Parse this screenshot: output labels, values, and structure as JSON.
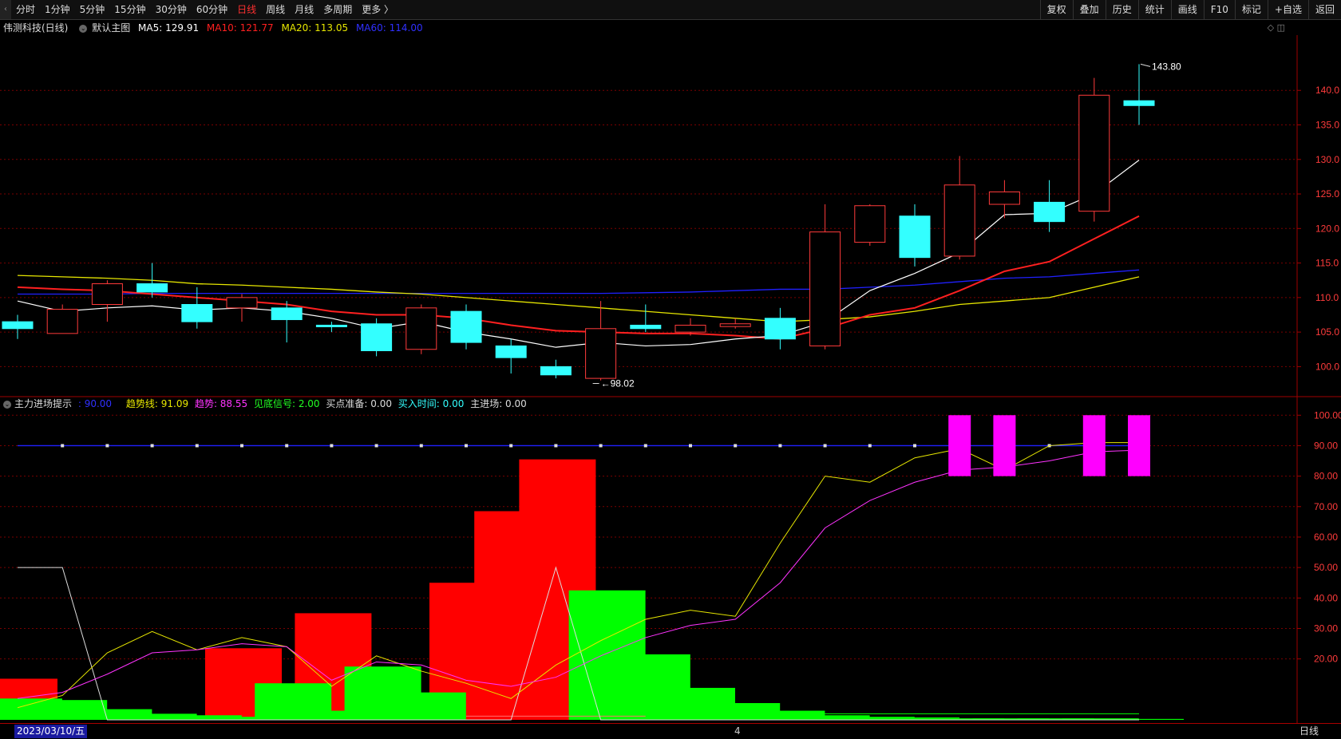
{
  "toolbar": {
    "back_icon": "chevron-left-icon",
    "periods": [
      {
        "label": "分时",
        "active": false
      },
      {
        "label": "1分钟",
        "active": false
      },
      {
        "label": "5分钟",
        "active": false
      },
      {
        "label": "15分钟",
        "active": false
      },
      {
        "label": "30分钟",
        "active": false
      },
      {
        "label": "60分钟",
        "active": false
      },
      {
        "label": "日线",
        "active": true
      },
      {
        "label": "周线",
        "active": false
      },
      {
        "label": "月线",
        "active": false
      },
      {
        "label": "多周期",
        "active": false
      },
      {
        "label": "更多 〉",
        "active": false
      }
    ],
    "actions": [
      "复权",
      "叠加",
      "历史",
      "统计",
      "画线",
      "F10",
      "标记",
      "+自选",
      "返回"
    ]
  },
  "main_info": {
    "stock": "伟测科技(日线)",
    "indicator": "默认主图",
    "ma5": "MA5: 129.91",
    "ma10": "MA10: 121.77",
    "ma20": "MA20: 113.05",
    "ma60": "MA60: 114.00"
  },
  "sub_info": {
    "name": "主力进场提示",
    "v1": ": 90.00",
    "trend_line": "趋势线: 91.09",
    "trend": "趋势: 88.55",
    "bottom_signal": "见底信号: 2.00",
    "buy_prepare": "买点准备: 0.00",
    "buy_time": "买入时间: 0.00",
    "main_entry": "主进场: 0.00"
  },
  "bottom": {
    "date": "2023/03/10/五",
    "marker": "4",
    "period": "日线"
  },
  "colors": {
    "up": "#ff3b3b",
    "down": "#33ffff",
    "ma5": "#ffffff",
    "ma10": "#ff2020",
    "ma20": "#e6e600",
    "ma60": "#2020ff",
    "grid": "#7a0000"
  },
  "chart_data": [
    {
      "type": "candlestick",
      "y_ticks": [
        100,
        105,
        110,
        115,
        120,
        125,
        130,
        135,
        140
      ],
      "ylim": [
        96,
        148
      ],
      "annotations": {
        "high": "143.80",
        "low": "98.02"
      },
      "candles": [
        {
          "o": 106.5,
          "h": 107.5,
          "l": 104.0,
          "c": 105.5
        },
        {
          "o": 104.8,
          "h": 109.0,
          "l": 104.8,
          "c": 108.3
        },
        {
          "o": 109.0,
          "h": 112.5,
          "l": 106.5,
          "c": 112.0
        },
        {
          "o": 112.0,
          "h": 115.0,
          "l": 110.0,
          "c": 110.8
        },
        {
          "o": 109.0,
          "h": 111.5,
          "l": 105.5,
          "c": 106.5
        },
        {
          "o": 108.5,
          "h": 110.5,
          "l": 106.5,
          "c": 110.0
        },
        {
          "o": 108.5,
          "h": 109.5,
          "l": 103.5,
          "c": 106.8
        },
        {
          "o": 106.0,
          "h": 106.5,
          "l": 105.0,
          "c": 105.8
        },
        {
          "o": 106.2,
          "h": 107.0,
          "l": 101.5,
          "c": 102.3
        },
        {
          "o": 102.5,
          "h": 109.0,
          "l": 101.8,
          "c": 108.5
        },
        {
          "o": 108.0,
          "h": 109.0,
          "l": 102.5,
          "c": 103.5
        },
        {
          "o": 103.0,
          "h": 104.0,
          "l": 99.0,
          "c": 101.3
        },
        {
          "o": 100.0,
          "h": 101.0,
          "l": 98.3,
          "c": 98.8
        },
        {
          "o": 98.3,
          "h": 109.5,
          "l": 98.0,
          "c": 105.5
        },
        {
          "o": 106.0,
          "h": 109.0,
          "l": 105.0,
          "c": 105.5
        },
        {
          "o": 105.0,
          "h": 107.0,
          "l": 104.5,
          "c": 106.0
        },
        {
          "o": 105.8,
          "h": 107.0,
          "l": 105.5,
          "c": 106.2
        },
        {
          "o": 107.0,
          "h": 108.5,
          "l": 102.5,
          "c": 104.0
        },
        {
          "o": 103.0,
          "h": 123.5,
          "l": 102.5,
          "c": 119.5
        },
        {
          "o": 118.0,
          "h": 123.5,
          "l": 117.5,
          "c": 123.3
        },
        {
          "o": 121.8,
          "h": 123.5,
          "l": 114.5,
          "c": 115.8
        },
        {
          "o": 116.0,
          "h": 130.5,
          "l": 115.5,
          "c": 126.3
        },
        {
          "o": 123.5,
          "h": 127.0,
          "l": 121.5,
          "c": 125.3
        },
        {
          "o": 123.8,
          "h": 127.0,
          "l": 119.5,
          "c": 121.0
        },
        {
          "o": 122.5,
          "h": 141.8,
          "l": 121.0,
          "c": 139.3
        },
        {
          "o": 138.5,
          "h": 143.8,
          "l": 135.0,
          "c": 137.8
        }
      ],
      "ma5": [
        109.5,
        108.0,
        108.5,
        108.8,
        108.2,
        108.5,
        108.0,
        107.0,
        105.5,
        106.5,
        105.0,
        104.0,
        102.8,
        103.5,
        103.0,
        103.2,
        104.0,
        104.5,
        106.5,
        111.0,
        113.5,
        116.5,
        122.0,
        122.2,
        125.0,
        129.9
      ],
      "ma10": [
        111.5,
        111.2,
        111.0,
        110.5,
        110.0,
        109.5,
        109.0,
        108.0,
        107.5,
        107.5,
        107.0,
        106.0,
        105.2,
        105.0,
        104.8,
        104.8,
        104.5,
        104.0,
        105.5,
        107.5,
        108.5,
        111.0,
        113.8,
        115.2,
        118.5,
        121.8
      ],
      "ma20": [
        113.2,
        113.0,
        112.8,
        112.5,
        112.0,
        111.8,
        111.5,
        111.2,
        110.8,
        110.5,
        110.0,
        109.5,
        109.0,
        108.5,
        108.0,
        107.5,
        107.0,
        106.5,
        106.8,
        107.2,
        108.0,
        109.0,
        109.5,
        110.0,
        111.5,
        113.0
      ],
      "ma60": [
        110.5,
        110.5,
        110.5,
        110.6,
        110.6,
        110.6,
        110.6,
        110.6,
        110.6,
        110.6,
        110.6,
        110.6,
        110.6,
        110.6,
        110.7,
        110.8,
        111.0,
        111.2,
        111.2,
        111.5,
        111.8,
        112.3,
        112.8,
        113.0,
        113.5,
        114.0
      ]
    },
    {
      "type": "bar",
      "name": "主力进场提示",
      "y_ticks": [
        20,
        30,
        40,
        50,
        60,
        70,
        80,
        90,
        100
      ],
      "ylim": [
        0,
        104
      ],
      "red_bars": [
        13.5,
        0,
        0,
        0,
        0,
        23.5,
        0,
        35,
        0,
        0,
        45,
        68.5,
        85.5,
        0,
        0,
        0,
        0,
        0,
        0,
        0,
        0,
        0,
        0,
        0,
        0,
        0
      ],
      "green_bars": [
        7,
        6.5,
        3.5,
        2,
        1.5,
        1,
        12,
        3,
        17.5,
        9,
        0,
        0,
        0,
        42.5,
        21.5,
        10.5,
        5.5,
        3,
        1.5,
        1,
        0.8,
        0.5,
        0.5,
        0.5,
        0.5,
        0.3
      ],
      "signal_bars": [
        0,
        0,
        0,
        0,
        0,
        0,
        0,
        0,
        0,
        0,
        0,
        0,
        0,
        0,
        0,
        0,
        0,
        0,
        0,
        0,
        0,
        1,
        1,
        0,
        1,
        1
      ],
      "level_line": 90,
      "white_line": [
        50,
        50,
        0,
        0,
        0,
        0,
        0,
        0,
        0,
        0,
        0,
        0,
        50,
        0,
        0,
        0,
        0,
        0,
        0,
        0,
        0,
        0,
        0,
        0,
        0,
        0
      ],
      "yellow_line": [
        4,
        8,
        22,
        29,
        23,
        27,
        24,
        11,
        21,
        16,
        12,
        7,
        18,
        26,
        33,
        36,
        34,
        58,
        80,
        78,
        86,
        89,
        82,
        90,
        91,
        91
      ],
      "magenta_line": [
        7,
        9,
        15,
        22,
        23,
        25,
        24,
        13,
        19,
        18,
        13,
        11,
        14,
        21,
        27,
        31,
        33,
        45,
        63,
        72,
        78,
        82,
        83,
        85,
        88,
        88.5
      ]
    }
  ]
}
